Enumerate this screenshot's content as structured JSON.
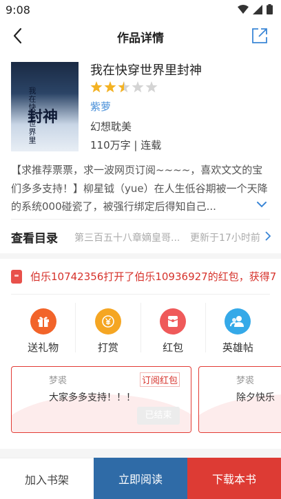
{
  "status": {
    "time": "9:08"
  },
  "nav": {
    "title": "作品详情"
  },
  "book": {
    "cover_text_small": "我在快穿世界里",
    "cover_text_big": "封神",
    "title": "我在快穿世界里封神",
    "rating": 2.5,
    "author": "紫萝",
    "genre": "幻想耽美",
    "stats": "110万字 | 连载",
    "description": "【求推荐票票，求一波网页订阅~~~~，喜欢文文的宝们多多支持！】柳星钺（yue）在人生低谷期被一个天降的系统000碰瓷了，被强行绑定后得知自己..."
  },
  "toc": {
    "label": "查看目录",
    "latest_chapter": "第三百五十八章嫡皇哥...",
    "update_time": "更新于17小时前"
  },
  "redpacket_notice": "伯乐10742356打开了伯乐10936927的红包，获得7",
  "actions": [
    {
      "label": "送礼物",
      "icon": "gift-icon",
      "color": "#f2642a"
    },
    {
      "label": "打赏",
      "icon": "yen-icon",
      "color": "#f5a623"
    },
    {
      "label": "红包",
      "icon": "redpacket-icon",
      "color": "#ef5a5a"
    },
    {
      "label": "英雄帖",
      "icon": "users-icon",
      "color": "#35a9e8"
    }
  ],
  "cards": [
    {
      "user": "梦裘",
      "tag": "订阅红包",
      "message": "大家多多支持！！！",
      "button": "已结束"
    },
    {
      "user": "梦裘",
      "tag": "",
      "message": "除夕快乐",
      "button": ""
    }
  ],
  "bottom": {
    "shelf": "加入书架",
    "read": "立即阅读",
    "download": "下载本书"
  },
  "colors": {
    "accent_blue": "#2f6ba7",
    "accent_red": "#dd3b34",
    "author_blue": "#4a90d9"
  }
}
